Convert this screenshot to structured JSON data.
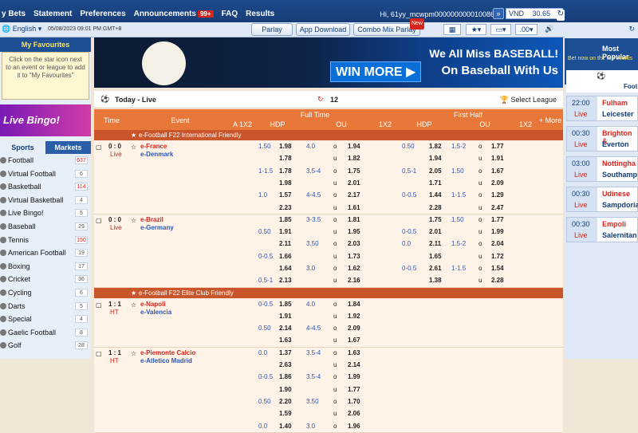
{
  "topnav": {
    "menu": [
      "y Bets",
      "Statement",
      "Preferences",
      "Announcements",
      "FAQ",
      "Results"
    ],
    "announce_badge": "99+",
    "user": "Hi, 61yy_mcwpm000000000010086",
    "currency": "VND",
    "balance": "30.65"
  },
  "subbar": {
    "lang": "English",
    "clock": "05/08/2023 09:01 PM GMT+8",
    "tabs": [
      "Parlay",
      "App Download",
      "Combo Mix Parlay"
    ],
    "new_tag": "New",
    "odds_type": ".00"
  },
  "left": {
    "fav_title": "My Favourites",
    "fav_text": "Click on the star icon next to an event or league to add it to \"My Favourites\"",
    "bingo": "Live Bingo!",
    "tabs": [
      "Sports",
      "Markets"
    ],
    "sports": [
      {
        "n": "Football",
        "c": "637"
      },
      {
        "n": "Virtual Football",
        "c": "6"
      },
      {
        "n": "Basketball",
        "c": "114"
      },
      {
        "n": "Virtual Basketball",
        "c": "4"
      },
      {
        "n": "Live Bingo!",
        "c": "5"
      },
      {
        "n": "Baseball",
        "c": "29"
      },
      {
        "n": "Tennis",
        "c": "150"
      },
      {
        "n": "American Football",
        "c": "19"
      },
      {
        "n": "Boxing",
        "c": "17"
      },
      {
        "n": "Cricket",
        "c": "36"
      },
      {
        "n": "Cycling",
        "c": "6"
      },
      {
        "n": "Darts",
        "c": "5"
      },
      {
        "n": "Special",
        "c": "4"
      },
      {
        "n": "Gaelic Football",
        "c": "8"
      },
      {
        "n": "Golf",
        "c": "28"
      }
    ]
  },
  "banner": {
    "t1": "We All Miss BASEBALL!",
    "t2": "WIN MORE",
    "t3": "On Baseball With Us"
  },
  "main": {
    "live_title": "Today - Live",
    "live_count": "12",
    "select_league": "Select League",
    "header": {
      "time": "Time",
      "event": "Event",
      "full": "Full Time",
      "first": "First Half",
      "a1x2": "A 1X2",
      "hdp": "HDP",
      "ou": "OU",
      "x2": "1X2",
      "more": "+ More"
    },
    "leagues": [
      "e-Football F22 International Friendly",
      "e-Football F22 Elite Club Friendly"
    ],
    "matches": [
      {
        "score": "0 : 0",
        "status": "Live",
        "home": "e-France",
        "away": "e-Denmark"
      },
      {
        "score": "0 : 0",
        "status": "Live",
        "home": "e-Brazil",
        "away": "e-Germany"
      },
      {
        "score": "1 : 1",
        "status": "HT",
        "home": "e-Napoli",
        "away": "e-Valencia"
      },
      {
        "score": "1 : 1",
        "status": "HT",
        "home": "e-Piemonte Calcio",
        "away": "e-Atletico Madrid"
      }
    ],
    "odds_rows": [
      [
        "1.50",
        "1.98",
        "4.0",
        "o",
        "1.94",
        "0.50",
        "1.82",
        "1.5-2",
        "o",
        "1.77"
      ],
      [
        "",
        "1.78",
        "",
        "u",
        "1.82",
        "",
        "1.94",
        "",
        "u",
        "1.91"
      ],
      [
        "1-1.5",
        "1.78",
        "3.5-4",
        "o",
        "1.75",
        "0.5-1",
        "2.05",
        "1.50",
        "o",
        "1.67"
      ],
      [
        "",
        "1.98",
        "",
        "u",
        "2.01",
        "",
        "1.71",
        "",
        "u",
        "2.09"
      ],
      [
        "1.0",
        "1.57",
        "4-4.5",
        "o",
        "2.17",
        "0-0.5",
        "1.44",
        "1-1.5",
        "o",
        "1.29"
      ],
      [
        "",
        "2.23",
        "",
        "u",
        "1.61",
        "",
        "2.28",
        "",
        "u",
        "2.47"
      ],
      [
        "",
        "1.85",
        "3-3.5",
        "o",
        "1.81",
        "",
        "1.75",
        "1.50",
        "o",
        "1.77"
      ],
      [
        "0.50",
        "1.91",
        "",
        "u",
        "1.95",
        "0-0.5",
        "2.01",
        "",
        "u",
        "1.99"
      ],
      [
        "",
        "2.11",
        "3.50",
        "o",
        "2.03",
        "0.0",
        "2.11",
        "1.5-2",
        "o",
        "2.04"
      ],
      [
        "0-0.5",
        "1.66",
        "",
        "u",
        "1.73",
        "",
        "1.65",
        "",
        "u",
        "1.72"
      ],
      [
        "",
        "1.64",
        "3.0",
        "o",
        "1.62",
        "0-0.5",
        "2.61",
        "1-1.5",
        "o",
        "1.54"
      ],
      [
        "0.5-1",
        "2.13",
        "",
        "u",
        "2.16",
        "",
        "1.38",
        "",
        "u",
        "2.28"
      ],
      [
        "0-0.5",
        "1.85",
        "4.0",
        "o",
        "1.84",
        "",
        "",
        "",
        "",
        ""
      ],
      [
        "",
        "1.91",
        "",
        "u",
        "1.92",
        "",
        "",
        "",
        "",
        ""
      ],
      [
        "0.50",
        "2.14",
        "4-4.5",
        "o",
        "2.09",
        "",
        "",
        "",
        "",
        ""
      ],
      [
        "",
        "1.63",
        "",
        "u",
        "1.67",
        "",
        "",
        "",
        "",
        ""
      ],
      [
        "0.0",
        "1.37",
        "3.5-4",
        "o",
        "1.63",
        "",
        "",
        "",
        "",
        ""
      ],
      [
        "",
        "2.63",
        "",
        "u",
        "2.14",
        "",
        "",
        "",
        "",
        ""
      ],
      [
        "0-0.5",
        "1.86",
        "3.5-4",
        "o",
        "1.99",
        "",
        "",
        "",
        "",
        ""
      ],
      [
        "",
        "1.90",
        "",
        "u",
        "1.77",
        "",
        "",
        "",
        "",
        ""
      ],
      [
        "0.50",
        "2.20",
        "3.50",
        "o",
        "1.70",
        "",
        "",
        "",
        "",
        ""
      ],
      [
        "",
        "1.59",
        "",
        "u",
        "2.06",
        "",
        "",
        "",
        "",
        ""
      ],
      [
        "0.0",
        "1.40",
        "3.0",
        "o",
        "1.96",
        "",
        "",
        "",
        "",
        ""
      ]
    ]
  },
  "right": {
    "title": "Most Popular",
    "sub": "Bet now on the top events",
    "label": "Footb",
    "games": [
      {
        "t": "22:00",
        "s": "Live",
        "h": "Fulham",
        "a": "Leicester"
      },
      {
        "t": "00:30",
        "s": "Live",
        "h": "Brighton &",
        "a": "Everton"
      },
      {
        "t": "03:00",
        "s": "Live",
        "h": "Nottingha",
        "a": "Southamp"
      },
      {
        "t": "00:30",
        "s": "Live",
        "h": "Udinese",
        "a": "Sampdoria"
      },
      {
        "t": "00:30",
        "s": "Live",
        "h": "Empoli",
        "a": "Salernitan"
      }
    ]
  }
}
